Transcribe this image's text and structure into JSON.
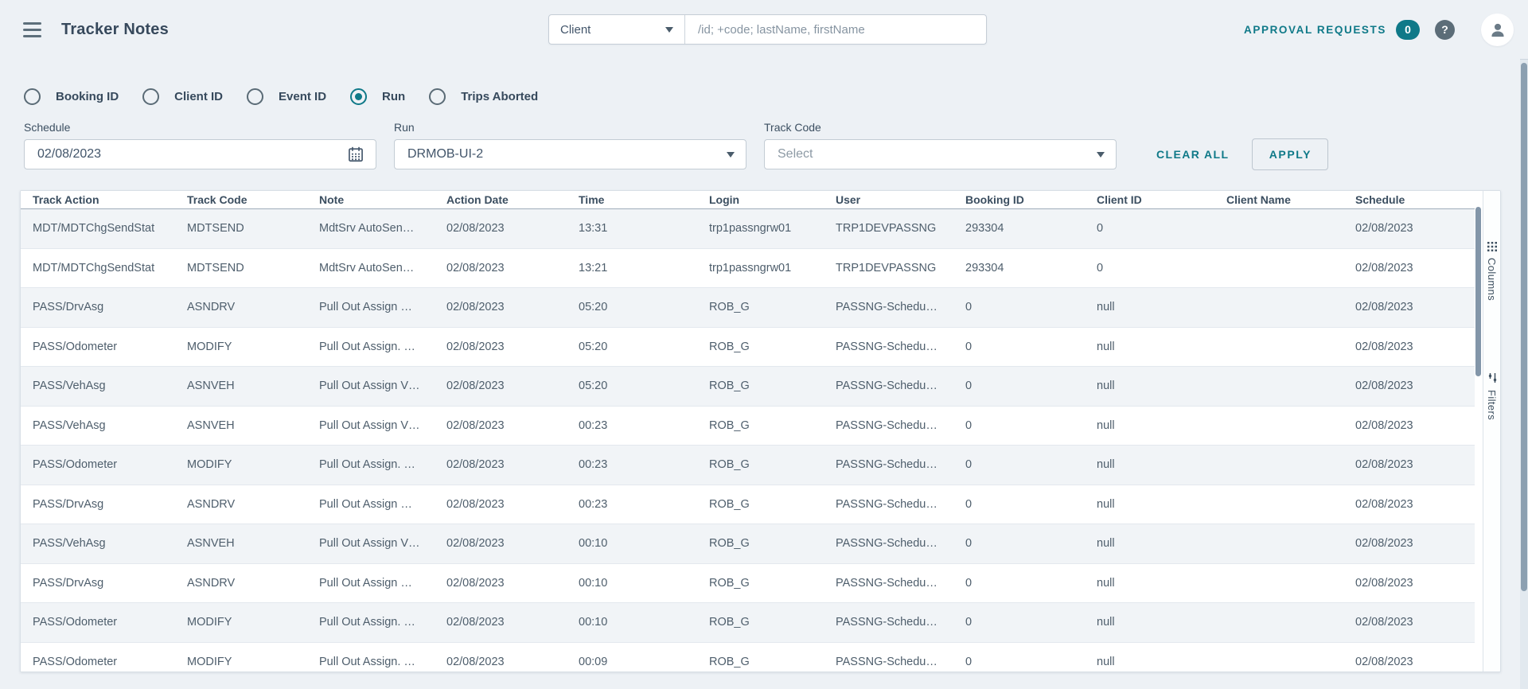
{
  "colors": {
    "accent_teal": "#0f7988",
    "page_bg": "#edf1f5",
    "row_stripe": "#f1f4f7",
    "text_dark": "#36495c",
    "text_body": "#4e5e6c"
  },
  "header": {
    "title": "Tracker Notes",
    "search_category": "Client",
    "search_placeholder": "/id; +code; lastName, firstName",
    "approval_requests_label": "APPROVAL REQUESTS",
    "approval_requests_count": "0",
    "help_glyph": "?"
  },
  "filters": {
    "radios": [
      {
        "label": "Booking ID",
        "selected": false
      },
      {
        "label": "Client ID",
        "selected": false
      },
      {
        "label": "Event ID",
        "selected": false
      },
      {
        "label": "Run",
        "selected": true
      },
      {
        "label": "Trips Aborted",
        "selected": false
      }
    ],
    "schedule_label": "Schedule",
    "schedule_value": "02/08/2023",
    "run_label": "Run",
    "run_value": "DRMOB-UI-2",
    "track_code_label": "Track Code",
    "track_code_value": "Select",
    "clear_all_label": "CLEAR ALL",
    "apply_label": "APPLY"
  },
  "table": {
    "columns": [
      "Track Action",
      "Track Code",
      "Note",
      "Action Date",
      "Time",
      "Login",
      "User",
      "Booking ID",
      "Client ID",
      "Client Name",
      "Schedule"
    ],
    "rows": [
      [
        "MDT/MDTChgSendStat",
        "MDTSEND",
        "MdtSrv AutoSen…",
        "02/08/2023",
        "13:31",
        "trp1passngrw01",
        "TRP1DEVPASSNG",
        "293304",
        "0",
        "",
        "02/08/2023"
      ],
      [
        "MDT/MDTChgSendStat",
        "MDTSEND",
        "MdtSrv AutoSen…",
        "02/08/2023",
        "13:21",
        "trp1passngrw01",
        "TRP1DEVPASSNG",
        "293304",
        "0",
        "",
        "02/08/2023"
      ],
      [
        "PASS/DrvAsg",
        "ASNDRV",
        "Pull Out Assign …",
        "02/08/2023",
        "05:20",
        "ROB_G",
        "PASSNG-Schedu…",
        "0",
        "null",
        "",
        "02/08/2023"
      ],
      [
        "PASS/Odometer",
        "MODIFY",
        "Pull Out Assign. …",
        "02/08/2023",
        "05:20",
        "ROB_G",
        "PASSNG-Schedu…",
        "0",
        "null",
        "",
        "02/08/2023"
      ],
      [
        "PASS/VehAsg",
        "ASNVEH",
        "Pull Out Assign V…",
        "02/08/2023",
        "05:20",
        "ROB_G",
        "PASSNG-Schedu…",
        "0",
        "null",
        "",
        "02/08/2023"
      ],
      [
        "PASS/VehAsg",
        "ASNVEH",
        "Pull Out Assign V…",
        "02/08/2023",
        "00:23",
        "ROB_G",
        "PASSNG-Schedu…",
        "0",
        "null",
        "",
        "02/08/2023"
      ],
      [
        "PASS/Odometer",
        "MODIFY",
        "Pull Out Assign. …",
        "02/08/2023",
        "00:23",
        "ROB_G",
        "PASSNG-Schedu…",
        "0",
        "null",
        "",
        "02/08/2023"
      ],
      [
        "PASS/DrvAsg",
        "ASNDRV",
        "Pull Out Assign …",
        "02/08/2023",
        "00:23",
        "ROB_G",
        "PASSNG-Schedu…",
        "0",
        "null",
        "",
        "02/08/2023"
      ],
      [
        "PASS/VehAsg",
        "ASNVEH",
        "Pull Out Assign V…",
        "02/08/2023",
        "00:10",
        "ROB_G",
        "PASSNG-Schedu…",
        "0",
        "null",
        "",
        "02/08/2023"
      ],
      [
        "PASS/DrvAsg",
        "ASNDRV",
        "Pull Out Assign …",
        "02/08/2023",
        "00:10",
        "ROB_G",
        "PASSNG-Schedu…",
        "0",
        "null",
        "",
        "02/08/2023"
      ],
      [
        "PASS/Odometer",
        "MODIFY",
        "Pull Out Assign. …",
        "02/08/2023",
        "00:10",
        "ROB_G",
        "PASSNG-Schedu…",
        "0",
        "null",
        "",
        "02/08/2023"
      ],
      [
        "PASS/Odometer",
        "MODIFY",
        "Pull Out Assign. …",
        "02/08/2023",
        "00:09",
        "ROB_G",
        "PASSNG-Schedu…",
        "0",
        "null",
        "",
        "02/08/2023"
      ]
    ]
  },
  "side_tabs": {
    "columns_label": "Columns",
    "filters_label": "Filters"
  }
}
